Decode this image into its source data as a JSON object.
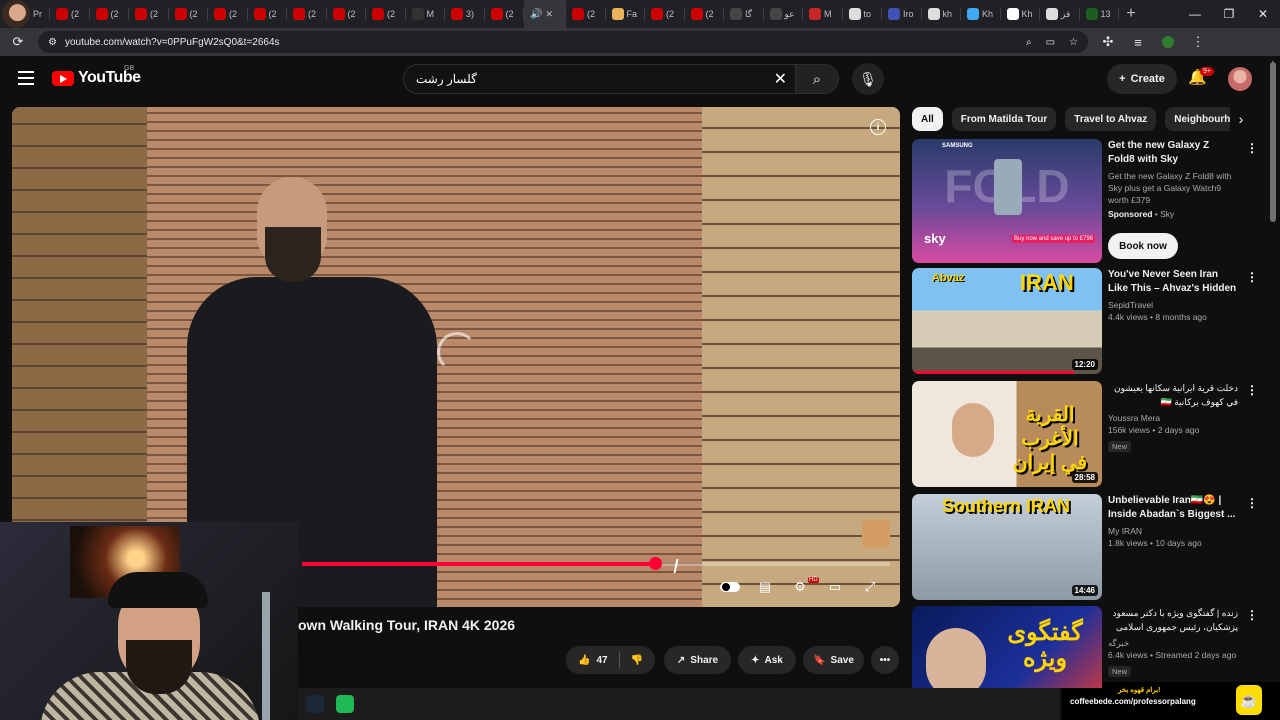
{
  "browser": {
    "tabs": [
      {
        "label": "Pr",
        "color": "#666666"
      },
      {
        "label": "(2",
        "color": "#cc0000"
      },
      {
        "label": "(2",
        "color": "#cc0000"
      },
      {
        "label": "(2",
        "color": "#cc0000"
      },
      {
        "label": "(2",
        "color": "#cc0000"
      },
      {
        "label": "(2",
        "color": "#cc0000"
      },
      {
        "label": "(2",
        "color": "#cc0000"
      },
      {
        "label": "(2",
        "color": "#cc0000"
      },
      {
        "label": "(2",
        "color": "#cc0000"
      },
      {
        "label": "(2",
        "color": "#cc0000"
      },
      {
        "label": "M",
        "color": "#333333"
      },
      {
        "label": "3)",
        "color": "#cc0000"
      },
      {
        "label": "(2",
        "color": "#cc0000"
      }
    ],
    "active_tab": {
      "close": "✕"
    },
    "tabs_right": [
      {
        "label": "(2",
        "color": "#cc0000"
      },
      {
        "label": "Fa",
        "color": "#e8b25a"
      },
      {
        "label": "(2",
        "color": "#cc0000"
      },
      {
        "label": "(2",
        "color": "#cc0000"
      },
      {
        "label": "گا",
        "color": "#444444"
      },
      {
        "label": "عو",
        "color": "#444444"
      },
      {
        "label": "M",
        "color": "#c62828"
      },
      {
        "label": "to",
        "color": "#dddddd"
      },
      {
        "label": "Iro",
        "color": "#3f51b5"
      },
      {
        "label": "kh",
        "color": "#dddddd"
      },
      {
        "label": "Kh",
        "color": "#3fa9f5"
      },
      {
        "label": "Kh",
        "color": "#ffffff"
      },
      {
        "label": "فز",
        "color": "#dddddd"
      },
      {
        "label": "13",
        "color": "#1b5e20"
      }
    ],
    "new_tab": "+",
    "url": "youtube.com/watch?v=0PPuFgW2sQ0&t=2664s"
  },
  "header": {
    "logo_text": "YouTube",
    "country": "GB",
    "search_value": "گلسار رشت",
    "create_label": "Create",
    "notifications_badge": "9+"
  },
  "player": {
    "progress_fraction": 0.6,
    "accent": "#ff0033"
  },
  "video": {
    "title": "own Walking Tour, IRAN 4K 2026",
    "likes": "47",
    "share_label": "Share",
    "ask_label": "Ask",
    "save_label": "Save"
  },
  "overlay": {
    "coffee_top": "برام قهوه بخر!",
    "coffee_url": "coffeebede.com/professorpalang"
  },
  "chips": [
    "All",
    "From Matilda Tour",
    "Travel to Ahvaz",
    "Neighbourho"
  ],
  "sidebar": {
    "ad": {
      "title": "Get the new Galaxy Z Fold8 with Sky",
      "description": "Get the new Galaxy Z Fold8 with Sky plus get a Galaxy Watch9 worth £379",
      "sponsored": "Sponsored",
      "advertiser": "Sky",
      "cta": "Book now",
      "thumb_brand": "SAMSUNG",
      "thumb_word": "FOLD",
      "thumb_sky": "sky",
      "thumb_offer": "Buy now and save up to £796"
    },
    "videos": [
      {
        "title": "You've Never Seen Iran Like This – Ahvaz's Hidden ...",
        "channel": "SepidTravel",
        "stats": "4.4k views • 8 months ago",
        "duration": "12:20",
        "badge": "",
        "thumb_text_1": "IRAN",
        "thumb_text_2": "Abvaz",
        "watched_fraction": 0.85
      },
      {
        "title": "دخلت قرية ايرانية سكانها يعيشون في كهوف بركانية 🇮🇷",
        "channel": "Youssra Mera",
        "stats": "156k views • 2 days ago",
        "duration": "28:58",
        "badge": "New",
        "thumb_text_1": "القرية الأغرب في إيران",
        "rtl": true
      },
      {
        "title": "Unbelievable Iran🇮🇷😍 | Inside Abadan`s Biggest ...",
        "channel": "My IRAN",
        "stats": "1.8k views • 10 days ago",
        "duration": "14:46",
        "badge": "",
        "thumb_text_1": "Southern IRAN"
      },
      {
        "title": "زنده | گفتگوی ویژه با دکتر مسعود پزشکیان، رئیس جمهوری اسلامی ایران",
        "channel": "خبرگه",
        "stats": "6.4k views • Streamed 2 days ago",
        "duration": "",
        "badge": "New",
        "thumb_text_1": "گفتگوی ویژه",
        "rtl": true
      }
    ]
  }
}
